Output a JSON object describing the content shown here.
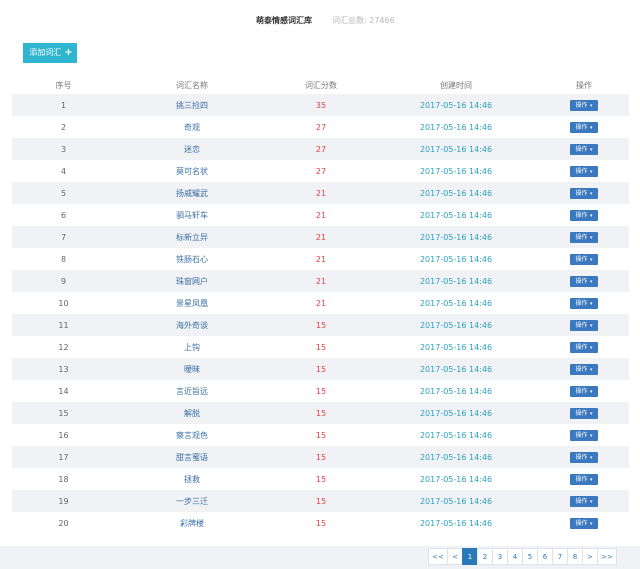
{
  "header": {
    "title": "萌泰情感词汇库",
    "total": "词汇总数: 27466"
  },
  "add_button": {
    "label": "添加词汇",
    "icon": "plus-icon"
  },
  "table": {
    "columns": [
      "序号",
      "词汇名称",
      "词汇分数",
      "创建时间",
      "操作"
    ],
    "rows": [
      {
        "idx": "1",
        "name": "挑三捡四",
        "score": "35",
        "date": "2017-05-16 14:46",
        "action": "操作"
      },
      {
        "idx": "2",
        "name": "奇观",
        "score": "27",
        "date": "2017-05-16 14:46",
        "action": "操作"
      },
      {
        "idx": "3",
        "name": "迷恋",
        "score": "27",
        "date": "2017-05-16 14:46",
        "action": "操作"
      },
      {
        "idx": "4",
        "name": "莫可名状",
        "score": "27",
        "date": "2017-05-16 14:46",
        "action": "操作"
      },
      {
        "idx": "5",
        "name": "扬威耀武",
        "score": "21",
        "date": "2017-05-16 14:46",
        "action": "操作"
      },
      {
        "idx": "6",
        "name": "驷马轩车",
        "score": "21",
        "date": "2017-05-16 14:46",
        "action": "操作"
      },
      {
        "idx": "7",
        "name": "标新立异",
        "score": "21",
        "date": "2017-05-16 14:46",
        "action": "操作"
      },
      {
        "idx": "8",
        "name": "铁肠石心",
        "score": "21",
        "date": "2017-05-16 14:46",
        "action": "操作"
      },
      {
        "idx": "9",
        "name": "珠窗网户",
        "score": "21",
        "date": "2017-05-16 14:46",
        "action": "操作"
      },
      {
        "idx": "10",
        "name": "景星凤凰",
        "score": "21",
        "date": "2017-05-16 14:46",
        "action": "操作"
      },
      {
        "idx": "11",
        "name": "海外奇谈",
        "score": "15",
        "date": "2017-05-16 14:46",
        "action": "操作"
      },
      {
        "idx": "12",
        "name": "上钩",
        "score": "15",
        "date": "2017-05-16 14:46",
        "action": "操作"
      },
      {
        "idx": "13",
        "name": "暧昧",
        "score": "15",
        "date": "2017-05-16 14:46",
        "action": "操作"
      },
      {
        "idx": "14",
        "name": "言近旨远",
        "score": "15",
        "date": "2017-05-16 14:46",
        "action": "操作"
      },
      {
        "idx": "15",
        "name": "解脱",
        "score": "15",
        "date": "2017-05-16 14:46",
        "action": "操作"
      },
      {
        "idx": "16",
        "name": "察言观色",
        "score": "15",
        "date": "2017-05-16 14:46",
        "action": "操作"
      },
      {
        "idx": "17",
        "name": "甜言蜜语",
        "score": "15",
        "date": "2017-05-16 14:46",
        "action": "操作"
      },
      {
        "idx": "18",
        "name": "拯救",
        "score": "15",
        "date": "2017-05-16 14:46",
        "action": "操作"
      },
      {
        "idx": "19",
        "name": "一步三迁",
        "score": "15",
        "date": "2017-05-16 14:46",
        "action": "操作"
      },
      {
        "idx": "20",
        "name": "彩牌楼",
        "score": "15",
        "date": "2017-05-16 14:46",
        "action": "操作"
      }
    ]
  },
  "pagination": {
    "first": "<<",
    "prev": "<",
    "pages": [
      "1",
      "2",
      "3",
      "4",
      "5",
      "6",
      "7",
      "8"
    ],
    "current": "1",
    "next": ">",
    "last": ">>"
  },
  "colors": {
    "accent": "#2fb5cf",
    "button": "#3a78bf",
    "score": "#e04343",
    "date": "#2aa2c1",
    "link": "#3a6fa6"
  }
}
